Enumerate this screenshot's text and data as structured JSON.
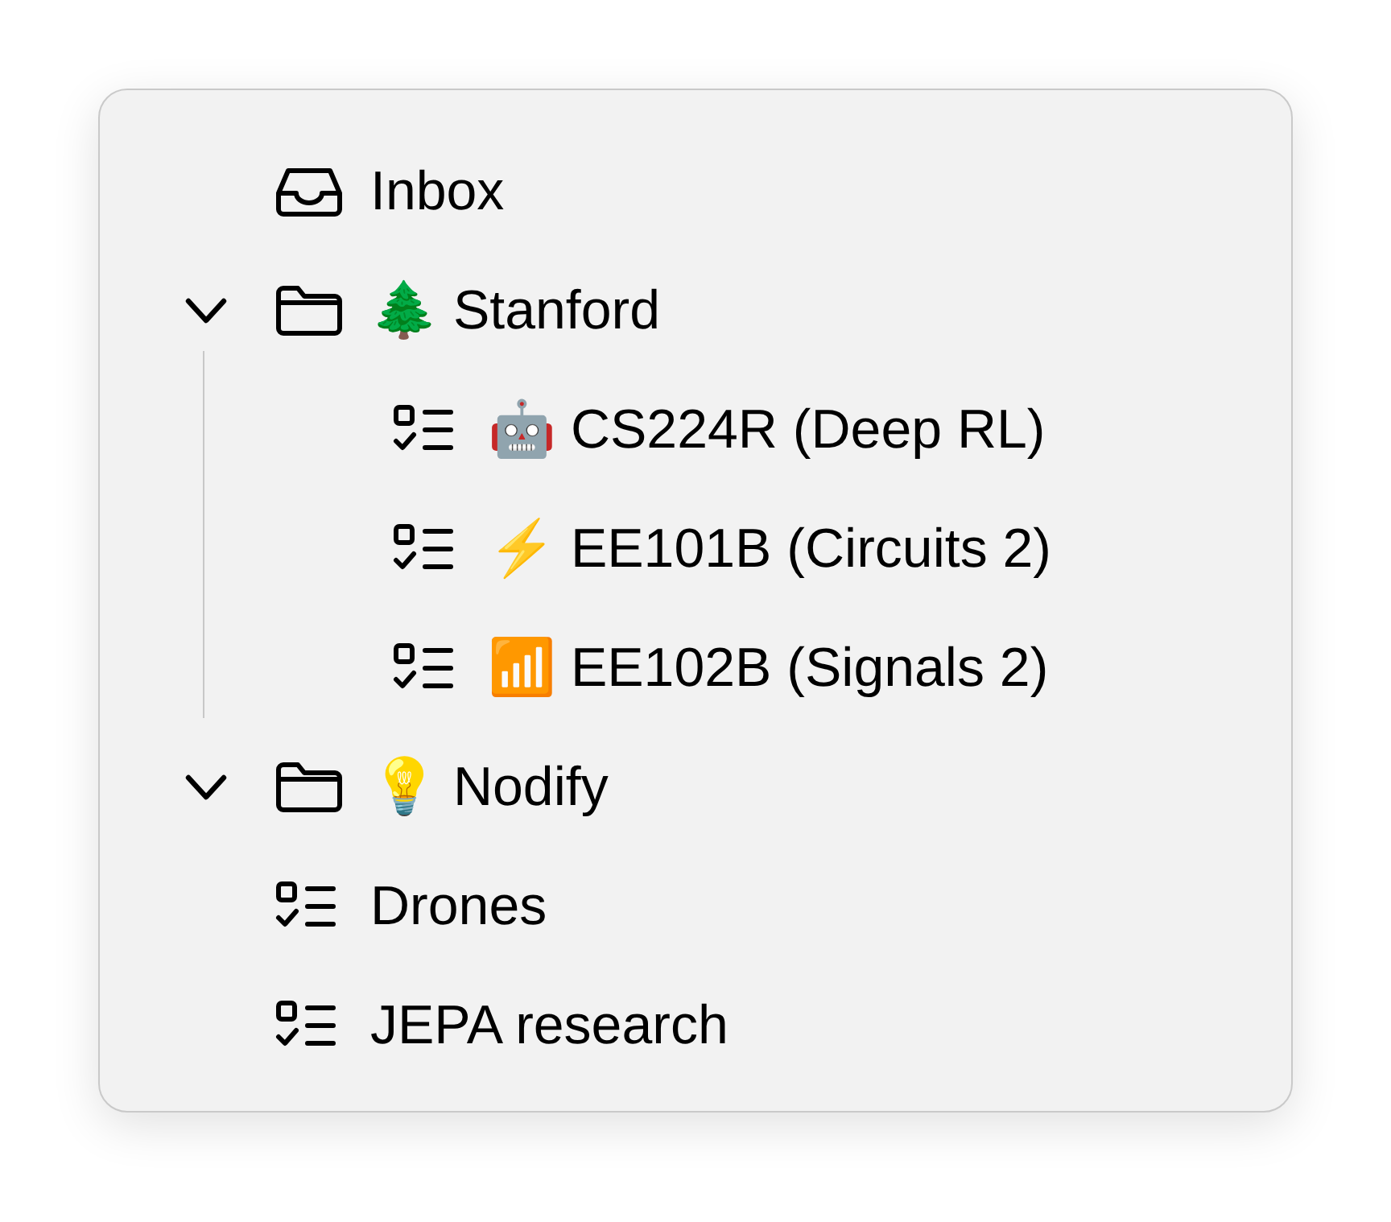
{
  "sidebar": {
    "items": [
      {
        "kind": "inbox",
        "label": "Inbox"
      },
      {
        "kind": "folder",
        "label": "🌲 Stanford",
        "expanded": true,
        "children": [
          {
            "kind": "list",
            "label": "🤖 CS224R (Deep RL)"
          },
          {
            "kind": "list",
            "label": "⚡ EE101B (Circuits 2)"
          },
          {
            "kind": "list",
            "label": "📶 EE102B (Signals 2)"
          }
        ]
      },
      {
        "kind": "folder",
        "label": "💡 Nodify",
        "expanded": true
      },
      {
        "kind": "list",
        "label": "Drones"
      },
      {
        "kind": "list",
        "label": "JEPA research"
      }
    ]
  }
}
